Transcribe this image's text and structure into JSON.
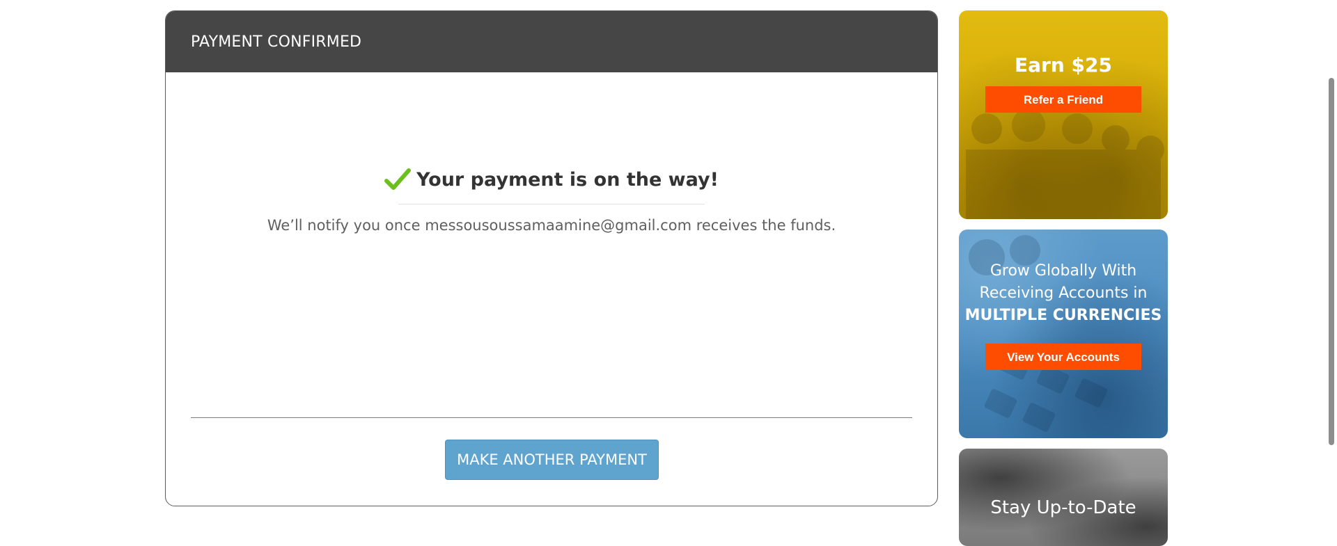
{
  "card": {
    "title": "PAYMENT CONFIRMED",
    "headline": "Your payment is on the way!",
    "notify": "We’ll notify you once messousoussamaamine@gmail.com receives the funds.",
    "button_label": "MAKE ANOTHER PAYMENT",
    "check_icon": "checkmark-icon",
    "check_color": "#6cbf1f"
  },
  "sidebar": {
    "refer": {
      "heading": "Earn $25",
      "button_label": "Refer a Friend"
    },
    "currencies": {
      "line1": "Grow Globally With",
      "line2": "Receiving Accounts in",
      "line3": "MULTIPLE CURRENCIES",
      "button_label": "View Your Accounts"
    },
    "update": {
      "title": "Stay Up-to-Date"
    }
  },
  "colors": {
    "header_bg": "#464646",
    "primary_button": "#5fa3cf",
    "promo_button": "#ff4d00",
    "refer_bg": "#d3aa07",
    "currencies_bg": "#4c8cc0"
  }
}
